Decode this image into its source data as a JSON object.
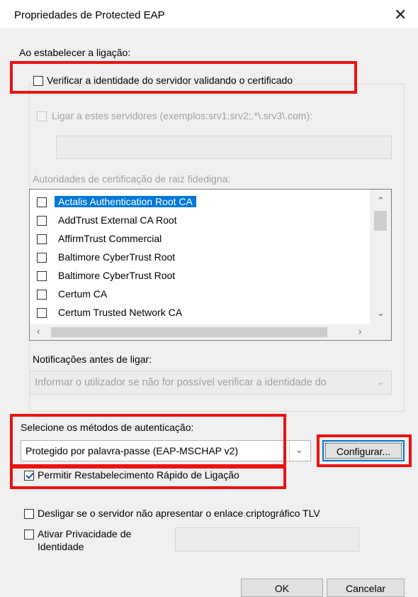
{
  "window": {
    "title": "Propriedades de Protected EAP",
    "close": "✕"
  },
  "connect_section": {
    "heading": "Ao estabelecer a ligação:",
    "verify_server_label": "Verificar a identidade do servidor validando o certificado",
    "verify_server_checked": false,
    "connect_servers_label": "Ligar a estes servidores (exemplos:srv1;srv2;.*\\.srv3\\.com):",
    "connect_servers_value": "",
    "root_ca_heading": "Autoridades de certificação de raiz fidedigna:",
    "root_cas": [
      {
        "name": "Actalis Authentication Root CA",
        "checked": false,
        "selected": true
      },
      {
        "name": "AddTrust External CA Root",
        "checked": false,
        "selected": false
      },
      {
        "name": "AffirmTrust Commercial",
        "checked": false,
        "selected": false
      },
      {
        "name": "Baltimore CyberTrust Root",
        "checked": false,
        "selected": false
      },
      {
        "name": "Baltimore CyberTrust Root",
        "checked": false,
        "selected": false
      },
      {
        "name": "Certum CA",
        "checked": false,
        "selected": false
      },
      {
        "name": "Certum Trusted Network CA",
        "checked": false,
        "selected": false
      }
    ],
    "notifications_label": "Notificações antes de ligar:",
    "notifications_value": "Informar o utilizador se não for possível verificar a identidade do"
  },
  "auth": {
    "heading": "Selecione os métodos de autenticação:",
    "method_value": "Protegido por palavra-passe (EAP-MSCHAP v2)",
    "configure_label": "Configurar...",
    "fast_reconnect_label": "Permitir Restabelecimento Rápido de Ligação",
    "fast_reconnect_checked": true,
    "disconnect_tlv_label": "Desligar se o servidor não apresentar o enlace criptográfico TLV",
    "identity_privacy_label_line1": "Ativar Privacidade de",
    "identity_privacy_label_line2": "Identidade",
    "identity_privacy_value": ""
  },
  "buttons": {
    "ok": "OK",
    "cancel": "Cancelar"
  }
}
